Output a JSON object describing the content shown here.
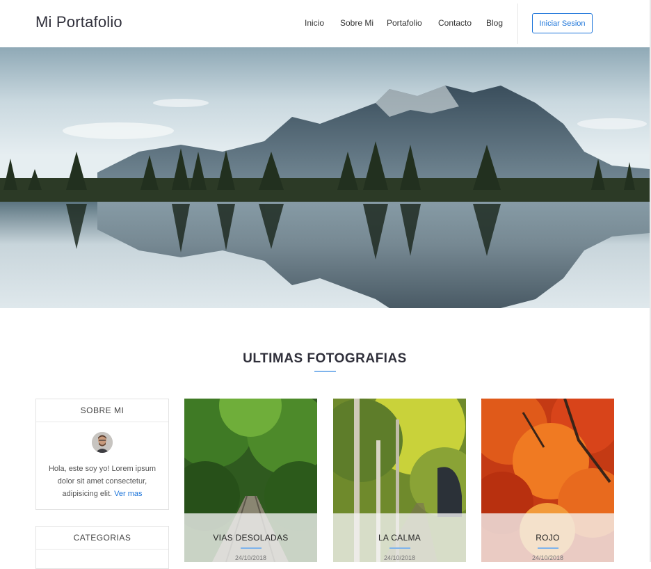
{
  "header": {
    "brand": "Mi Portafolio",
    "nav": [
      "Inicio",
      "Sobre Mi",
      "Portafolio",
      "Contacto",
      "Blog"
    ],
    "login_label": "Iniciar Sesion"
  },
  "hero": {
    "image": "mountain-lake-reflection"
  },
  "section": {
    "title": "ULTIMAS FOTOGRAFIAS"
  },
  "sidebar": {
    "about": {
      "title": "SOBRE MI",
      "text": "Hola, este soy yo! Lorem ipsum dolor sit amet consectetur, adipisicing elit.",
      "more_label": "Ver mas"
    },
    "categories": {
      "title": "CATEGORIAS"
    }
  },
  "cards": [
    {
      "title": "VIAS DESOLADAS",
      "date": "24/10/2018",
      "image": "forest-railway"
    },
    {
      "title": "LA CALMA",
      "date": "24/10/2018",
      "image": "forest-path"
    },
    {
      "title": "ROJO",
      "date": "24/10/2018",
      "image": "red-autumn-tree"
    }
  ],
  "colors": {
    "accent": "#1a73d9",
    "underline": "#7fb4ec"
  }
}
